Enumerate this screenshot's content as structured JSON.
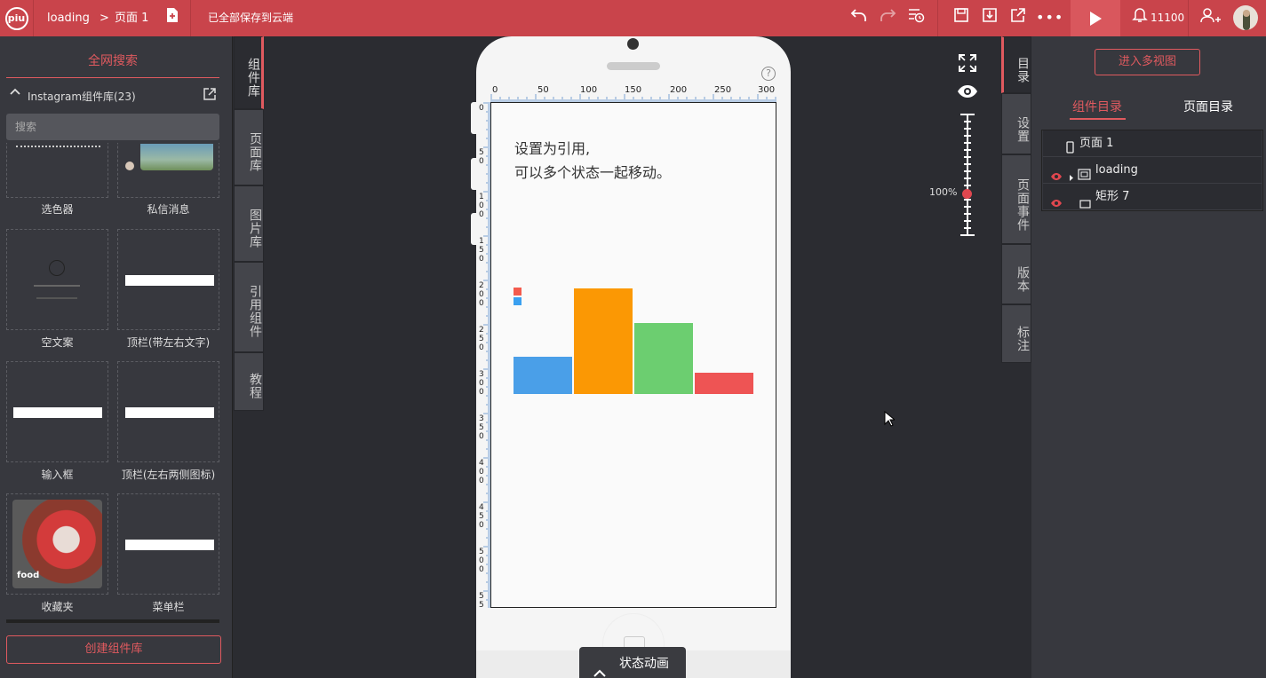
{
  "topbar": {
    "logo_text": "piu",
    "project_name": "loading",
    "breadcrumb_sep": ">",
    "page_name": "页面 1",
    "save_status": "已全部保存到云端",
    "notification_count": "11100"
  },
  "left_panel": {
    "title": "全网搜索",
    "library_name": "Instagram组件库(23)",
    "search_placeholder": "搜索",
    "components": [
      {
        "label": "选色器"
      },
      {
        "label": "私信消息"
      },
      {
        "label": "空文案"
      },
      {
        "label": "顶栏(带左右文字)"
      },
      {
        "label": "输入框"
      },
      {
        "label": "顶栏(左右两侧图标)"
      },
      {
        "label": "收藏夹"
      },
      {
        "label": "菜单栏"
      }
    ],
    "food_text": "food",
    "create_button": "创建组件库"
  },
  "left_tabs": [
    "组件库",
    "页面库",
    "图片库",
    "引用组件",
    "教程"
  ],
  "canvas": {
    "ruler_ticks": [
      "0",
      "50",
      "100",
      "150",
      "200",
      "250",
      "300"
    ],
    "vertical_ruler_ticks": [
      "0",
      "50",
      "100",
      "150",
      "200",
      "250",
      "300",
      "350",
      "400",
      "450",
      "500",
      "55"
    ],
    "text_line1": "设置为引用,",
    "text_line2": "可以多个状态一起移动。",
    "bars": [
      {
        "color": "#4a9fe8",
        "height": 42
      },
      {
        "color": "#fb9804",
        "height": 119
      },
      {
        "color": "#6cce70",
        "height": 80
      },
      {
        "color": "#ee5454",
        "height": 24
      }
    ],
    "help_icon": "?",
    "zoom_level": "100%",
    "state_animation": "状态动画"
  },
  "right_tabs": [
    "目录",
    "设置",
    "页面事件",
    "版本",
    "标注"
  ],
  "right_panel": {
    "multi_view_button": "进入多视图",
    "tab_components": "组件目录",
    "tab_pages": "页面目录",
    "tree": [
      {
        "label": "页面 1"
      },
      {
        "label": "loading"
      },
      {
        "label": "矩形 7"
      }
    ]
  },
  "colors": {
    "accent": "#c9444b",
    "panel": "#37383e",
    "canvas_bg": "#2b2c31"
  }
}
